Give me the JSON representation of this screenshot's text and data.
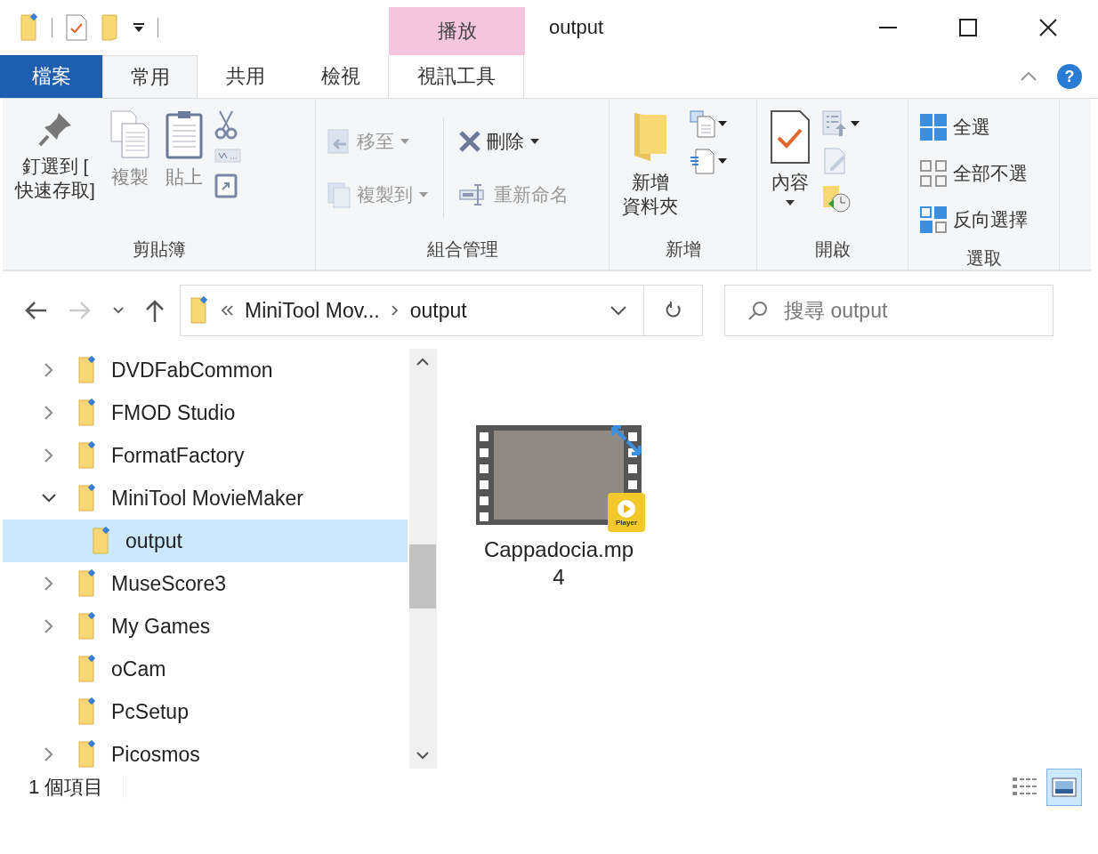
{
  "window": {
    "title": "output",
    "contextual_group": "播放"
  },
  "ribbon_tabs": [
    {
      "label": "檔案",
      "kind": "file",
      "selected": false
    },
    {
      "label": "常用",
      "kind": "tab",
      "selected": true
    },
    {
      "label": "共用",
      "kind": "tab",
      "selected": false
    },
    {
      "label": "檢視",
      "kind": "tab",
      "selected": false
    },
    {
      "label": "視訊工具",
      "kind": "contextual",
      "selected": false
    }
  ],
  "help": {
    "label": "?"
  },
  "ribbon_groups": [
    {
      "label": "剪貼簿",
      "buttons": [
        {
          "lines": [
            "釘選到 [",
            "快速存取]"
          ],
          "disabled": false,
          "dropdown": false
        },
        {
          "lines": [
            "複製"
          ],
          "disabled": true,
          "dropdown": false
        },
        {
          "lines": [
            "貼上"
          ],
          "disabled": true,
          "dropdown": false
        }
      ]
    },
    {
      "label": "組合管理",
      "buttons": [
        {
          "label": "移至",
          "disabled": true,
          "dropdown": true
        },
        {
          "label": "複製到",
          "disabled": true,
          "dropdown": true
        },
        {
          "label": "刪除",
          "disabled": false,
          "dropdown": true
        },
        {
          "label": "重新命名",
          "disabled": true,
          "dropdown": false
        }
      ]
    },
    {
      "label": "新增",
      "buttons": [
        {
          "lines": [
            "新增",
            "資料夾"
          ],
          "disabled": false,
          "dropdown": false
        }
      ]
    },
    {
      "label": "開啟",
      "buttons": [
        {
          "lines": [
            "內容"
          ],
          "disabled": false,
          "dropdown": true
        }
      ]
    },
    {
      "label": "選取",
      "buttons": [
        {
          "label": "全選",
          "disabled": false,
          "dropdown": false
        },
        {
          "label": "全部不選",
          "disabled": false,
          "dropdown": false
        },
        {
          "label": "反向選擇",
          "disabled": false,
          "dropdown": false
        }
      ]
    }
  ],
  "navigation": {
    "forward_disabled": true
  },
  "address_bar": {
    "crumbs": [
      "MiniTool Mov...",
      "output"
    ]
  },
  "search": {
    "placeholder": "搜尋 output"
  },
  "tree": [
    {
      "label": "DVDFabCommon",
      "expanded": false,
      "selected": false
    },
    {
      "label": "FMOD Studio",
      "expanded": false,
      "selected": false
    },
    {
      "label": "FormatFactory",
      "expanded": false,
      "selected": false
    },
    {
      "label": "MiniTool MovieMaker",
      "expanded": true,
      "selected": false,
      "children": [
        {
          "label": "output",
          "selected": true
        }
      ]
    },
    {
      "label": "MuseScore3",
      "expanded": false,
      "selected": false
    },
    {
      "label": "My Games",
      "expanded": false,
      "selected": false
    },
    {
      "label": "oCam",
      "selected": false
    },
    {
      "label": "PcSetup",
      "selected": false
    },
    {
      "label": "Picosmos",
      "expanded": false,
      "selected": false
    }
  ],
  "files": [
    {
      "name": "Cappadocia.mp4",
      "badge": "Player",
      "selected": false
    }
  ],
  "status_bar": {
    "item_count": "1 個項目",
    "views": [
      {
        "kind": "details",
        "selected": false
      },
      {
        "kind": "large-icons",
        "selected": true
      }
    ]
  }
}
